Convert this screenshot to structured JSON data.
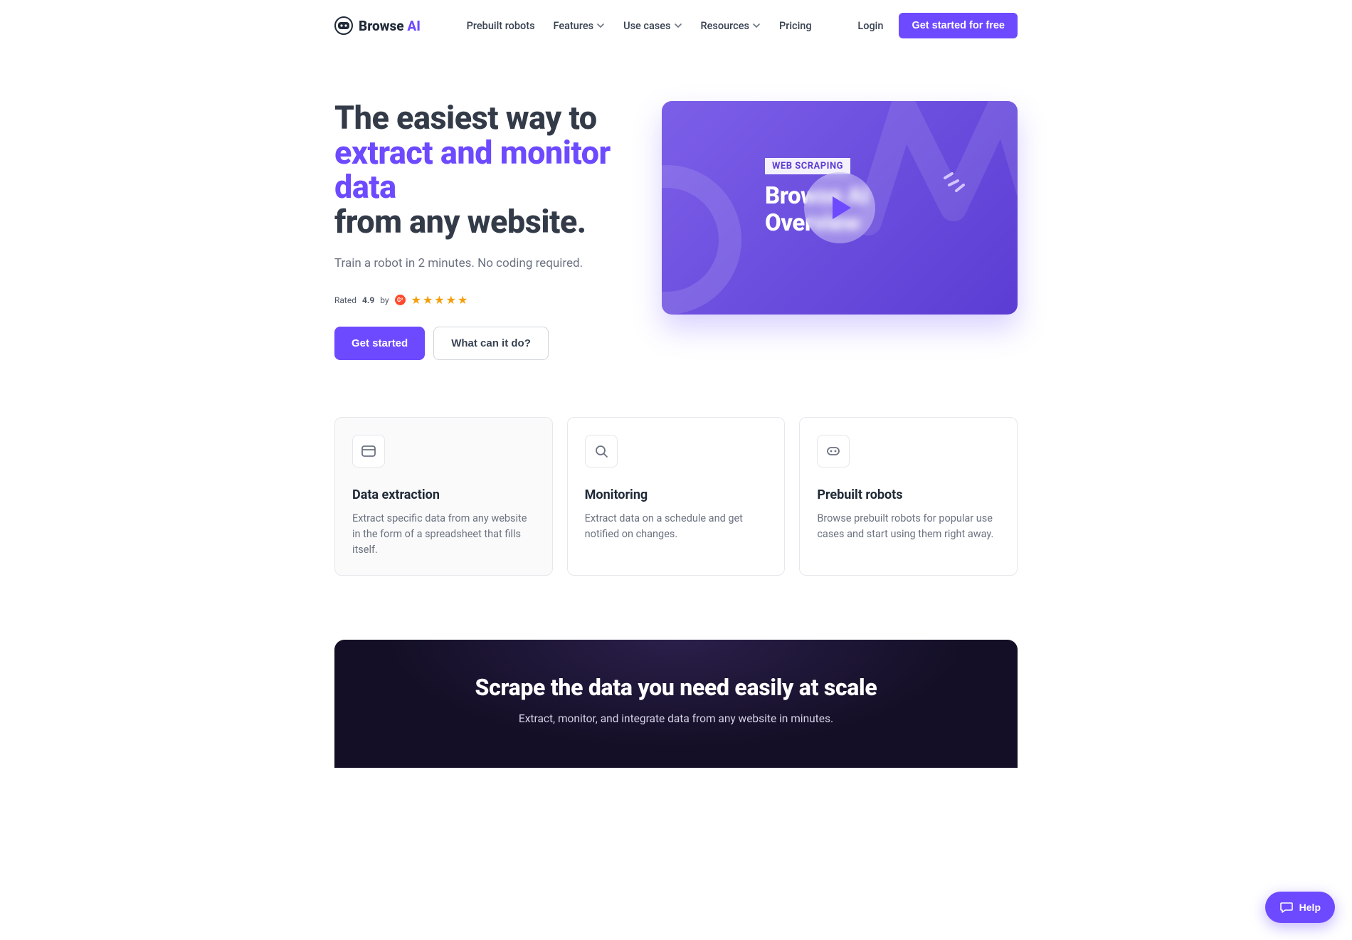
{
  "header": {
    "brand_first": "Browse",
    "brand_second": "AI",
    "nav": {
      "prebuilt": "Prebuilt robots",
      "features": "Features",
      "use_cases": "Use cases",
      "resources": "Resources",
      "pricing": "Pricing"
    },
    "login": "Login",
    "cta": "Get started for free"
  },
  "hero": {
    "title_1": "The easiest way to",
    "title_2": "extract and monitor data",
    "title_3": "from any website.",
    "subtitle": "Train a robot in 2 minutes. No coding required.",
    "rating_prefix": "Rated",
    "rating_value": "4.9",
    "rating_by": "by",
    "g2_text": "G²",
    "btn_primary": "Get started",
    "btn_secondary": "What can it do?",
    "video_badge": "WEB SCRAPING",
    "video_title_1": "Browse AI",
    "video_title_2": "Overview"
  },
  "features": [
    {
      "title": "Data extraction",
      "desc": "Extract specific data from any website in the form of a spreadsheet that fills itself."
    },
    {
      "title": "Monitoring",
      "desc": "Extract data on a schedule and get notified on changes."
    },
    {
      "title": "Prebuilt robots",
      "desc": "Browse prebuilt robots for popular use cases and start using them right away."
    }
  ],
  "cta_section": {
    "title": "Scrape the data you need easily at scale",
    "subtitle": "Extract, monitor, and integrate data from any website in minutes."
  },
  "help": {
    "label": "Help"
  }
}
